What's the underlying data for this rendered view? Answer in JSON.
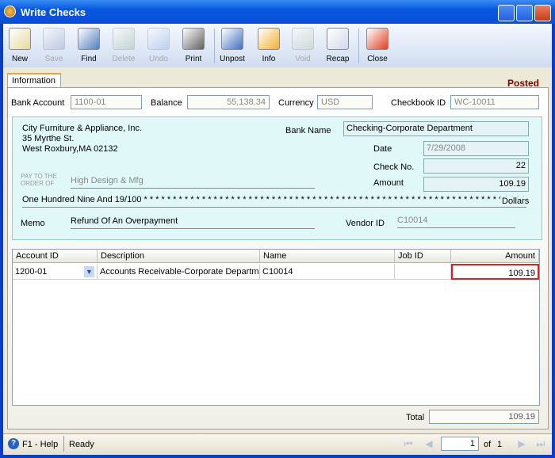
{
  "window": {
    "title": "Write Checks"
  },
  "toolbar": [
    {
      "label": "New",
      "icon": "new-icon",
      "enabled": true
    },
    {
      "label": "Save",
      "icon": "save-icon",
      "enabled": false
    },
    {
      "label": "Find",
      "icon": "find-icon",
      "enabled": true
    },
    {
      "label": "Delete",
      "icon": "delete-icon",
      "enabled": false
    },
    {
      "label": "Undo",
      "icon": "undo-icon",
      "enabled": false
    },
    {
      "label": "Print",
      "icon": "print-icon",
      "enabled": true
    },
    {
      "label": "Unpost",
      "icon": "unpost-icon",
      "enabled": true
    },
    {
      "label": "Info",
      "icon": "info-icon",
      "enabled": true
    },
    {
      "label": "Void",
      "icon": "void-icon",
      "enabled": false
    },
    {
      "label": "Recap",
      "icon": "recap-icon",
      "enabled": true
    },
    {
      "label": "Close",
      "icon": "close-icon",
      "enabled": true
    }
  ],
  "tab": "Information",
  "status_badge": "Posted",
  "header": {
    "bank_account_label": "Bank Account",
    "bank_account": "1100-01",
    "balance_label": "Balance",
    "balance": "55,138.34",
    "currency_label": "Currency",
    "currency": "USD",
    "checkbook_label": "Checkbook ID",
    "checkbook": "WC-10011"
  },
  "check": {
    "company_line1": "City Furniture & Appliance, Inc.",
    "company_line2": "35 Myrthe St.",
    "company_line3": "West Roxbury,MA 02132",
    "bank_name_label": "Bank Name",
    "bank_name": "Checking-Corporate Department",
    "date_label": "Date",
    "date": "7/29/2008",
    "check_no_label": "Check No.",
    "check_no": "22",
    "amount_label": "Amount",
    "amount": "109.19",
    "pay_to_label_1": "PAY TO THE",
    "pay_to_label_2": "ORDER OF",
    "pay_to": "High Design & Mfg",
    "amount_words": "One Hundred Nine And 19/100 * * * * * * * * * * * * * * * * * * * * * * * * * * * * * * * * * * * * * * * * * * * * * * * * * * * * * * * * * * * * * * * * * * * * * * * *",
    "dollars_label": "Dollars",
    "memo_label": "Memo",
    "memo": "Refund Of An Overpayment",
    "vendor_label": "Vendor ID",
    "vendor": "C10014"
  },
  "grid": {
    "columns": [
      "Account ID",
      "Description",
      "Name",
      "Job ID",
      "Amount"
    ],
    "rows": [
      [
        "1200-01",
        "Accounts Receivable-Corporate Departme",
        "C10014",
        "",
        "109.19"
      ]
    ]
  },
  "total_label": "Total",
  "total": "109.19",
  "statusbar": {
    "help": "F1 - Help",
    "status": "Ready",
    "page": "1",
    "of_label": "of",
    "pages": "1"
  },
  "colors": {
    "accent": "#800000",
    "highlight": "#e02020",
    "check_bg": "#e0f8f8"
  }
}
